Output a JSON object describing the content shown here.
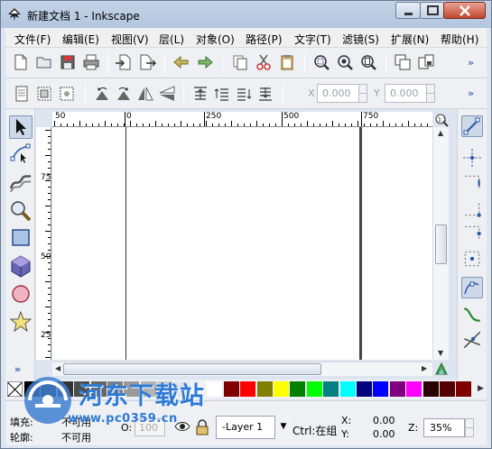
{
  "window": {
    "title": "新建文档 1 - Inkscape"
  },
  "menubar": {
    "items": [
      "文件(F)",
      "编辑(E)",
      "视图(V)",
      "层(L)",
      "对象(O)",
      "路径(P)",
      "文字(T)",
      "滤镜(S)",
      "扩展(N)",
      "帮助(H)"
    ]
  },
  "toolbar_commands": {
    "icons": [
      "new-document-icon",
      "open-icon",
      "save-icon",
      "print-icon",
      "import-icon",
      "export-icon",
      "undo-icon",
      "redo-icon",
      "copy-icon",
      "cut-icon",
      "paste-icon",
      "zoom-selection-icon",
      "zoom-drawing-icon",
      "zoom-page-icon",
      "duplicate-icon",
      "clone-icon"
    ],
    "more_label": "»"
  },
  "toolbar_select": {
    "icons": [
      "select-all-icon",
      "select-all-layers-icon",
      "deselect-icon",
      "rotate-ccw-icon",
      "rotate-cw-icon",
      "flip-horizontal-icon",
      "flip-vertical-icon",
      "raise-to-top-icon",
      "raise-icon",
      "lower-icon",
      "lower-to-bottom-icon"
    ],
    "x_label": "X",
    "x_value": "0.000",
    "y_label": "Y",
    "y_value": "0.000",
    "more_label": "»"
  },
  "toolbox": {
    "tools": [
      "selector-tool-icon",
      "node-tool-icon",
      "tweak-tool-icon",
      "zoom-tool-icon",
      "rectangle-tool-icon",
      "3d-box-tool-icon",
      "ellipse-tool-icon",
      "star-tool-icon"
    ],
    "active": "selector-tool-icon",
    "more_label": "»"
  },
  "rulers": {
    "top_labels": [
      "50",
      "0",
      "250",
      "500",
      "750"
    ],
    "left_labels": [
      "750",
      "500",
      "250"
    ]
  },
  "snap_toolbar": {
    "icons": [
      "snap-toggle-icon",
      "snap-bbox-icon",
      "snap-bbox-edge-icon",
      "snap-bbox-corner-icon",
      "snap-bbox-midpoint-icon",
      "snap-bbox-center-icon",
      "snap-nodes-icon",
      "snap-paths-icon",
      "snap-intersections-icon"
    ],
    "more_label": "»"
  },
  "palette": {
    "colors": [
      "#000000",
      "#1a1a1a",
      "#333333",
      "#4d4d4d",
      "#666666",
      "#808080",
      "#999999",
      "#b3b3b3",
      "#cccccc",
      "#e6e6e6",
      "#f2f2f2",
      "#ffffff",
      "#800000",
      "#ff0000",
      "#808000",
      "#ffff00",
      "#008000",
      "#00ff00",
      "#008080",
      "#00ffff",
      "#000080",
      "#0000ff",
      "#800080",
      "#ff00ff",
      "#2b0000",
      "#550000",
      "#800000"
    ],
    "more_label": "▶"
  },
  "statusbar": {
    "fill_label": "填充:",
    "fill_value": "不可用",
    "stroke_label": "轮廓:",
    "stroke_value": "不可用",
    "opacity_label": "O:",
    "opacity_value": "100",
    "layer_name": "-Layer 1",
    "message": "Ctrl:在组",
    "x_label": "X:",
    "x_value": "0.00",
    "y_label": "Y:",
    "y_value": "0.00",
    "zoom_label": "Z:",
    "zoom_value": "35%"
  },
  "watermark": {
    "name": "河东下载站",
    "url": "www.pc0359.cn"
  }
}
